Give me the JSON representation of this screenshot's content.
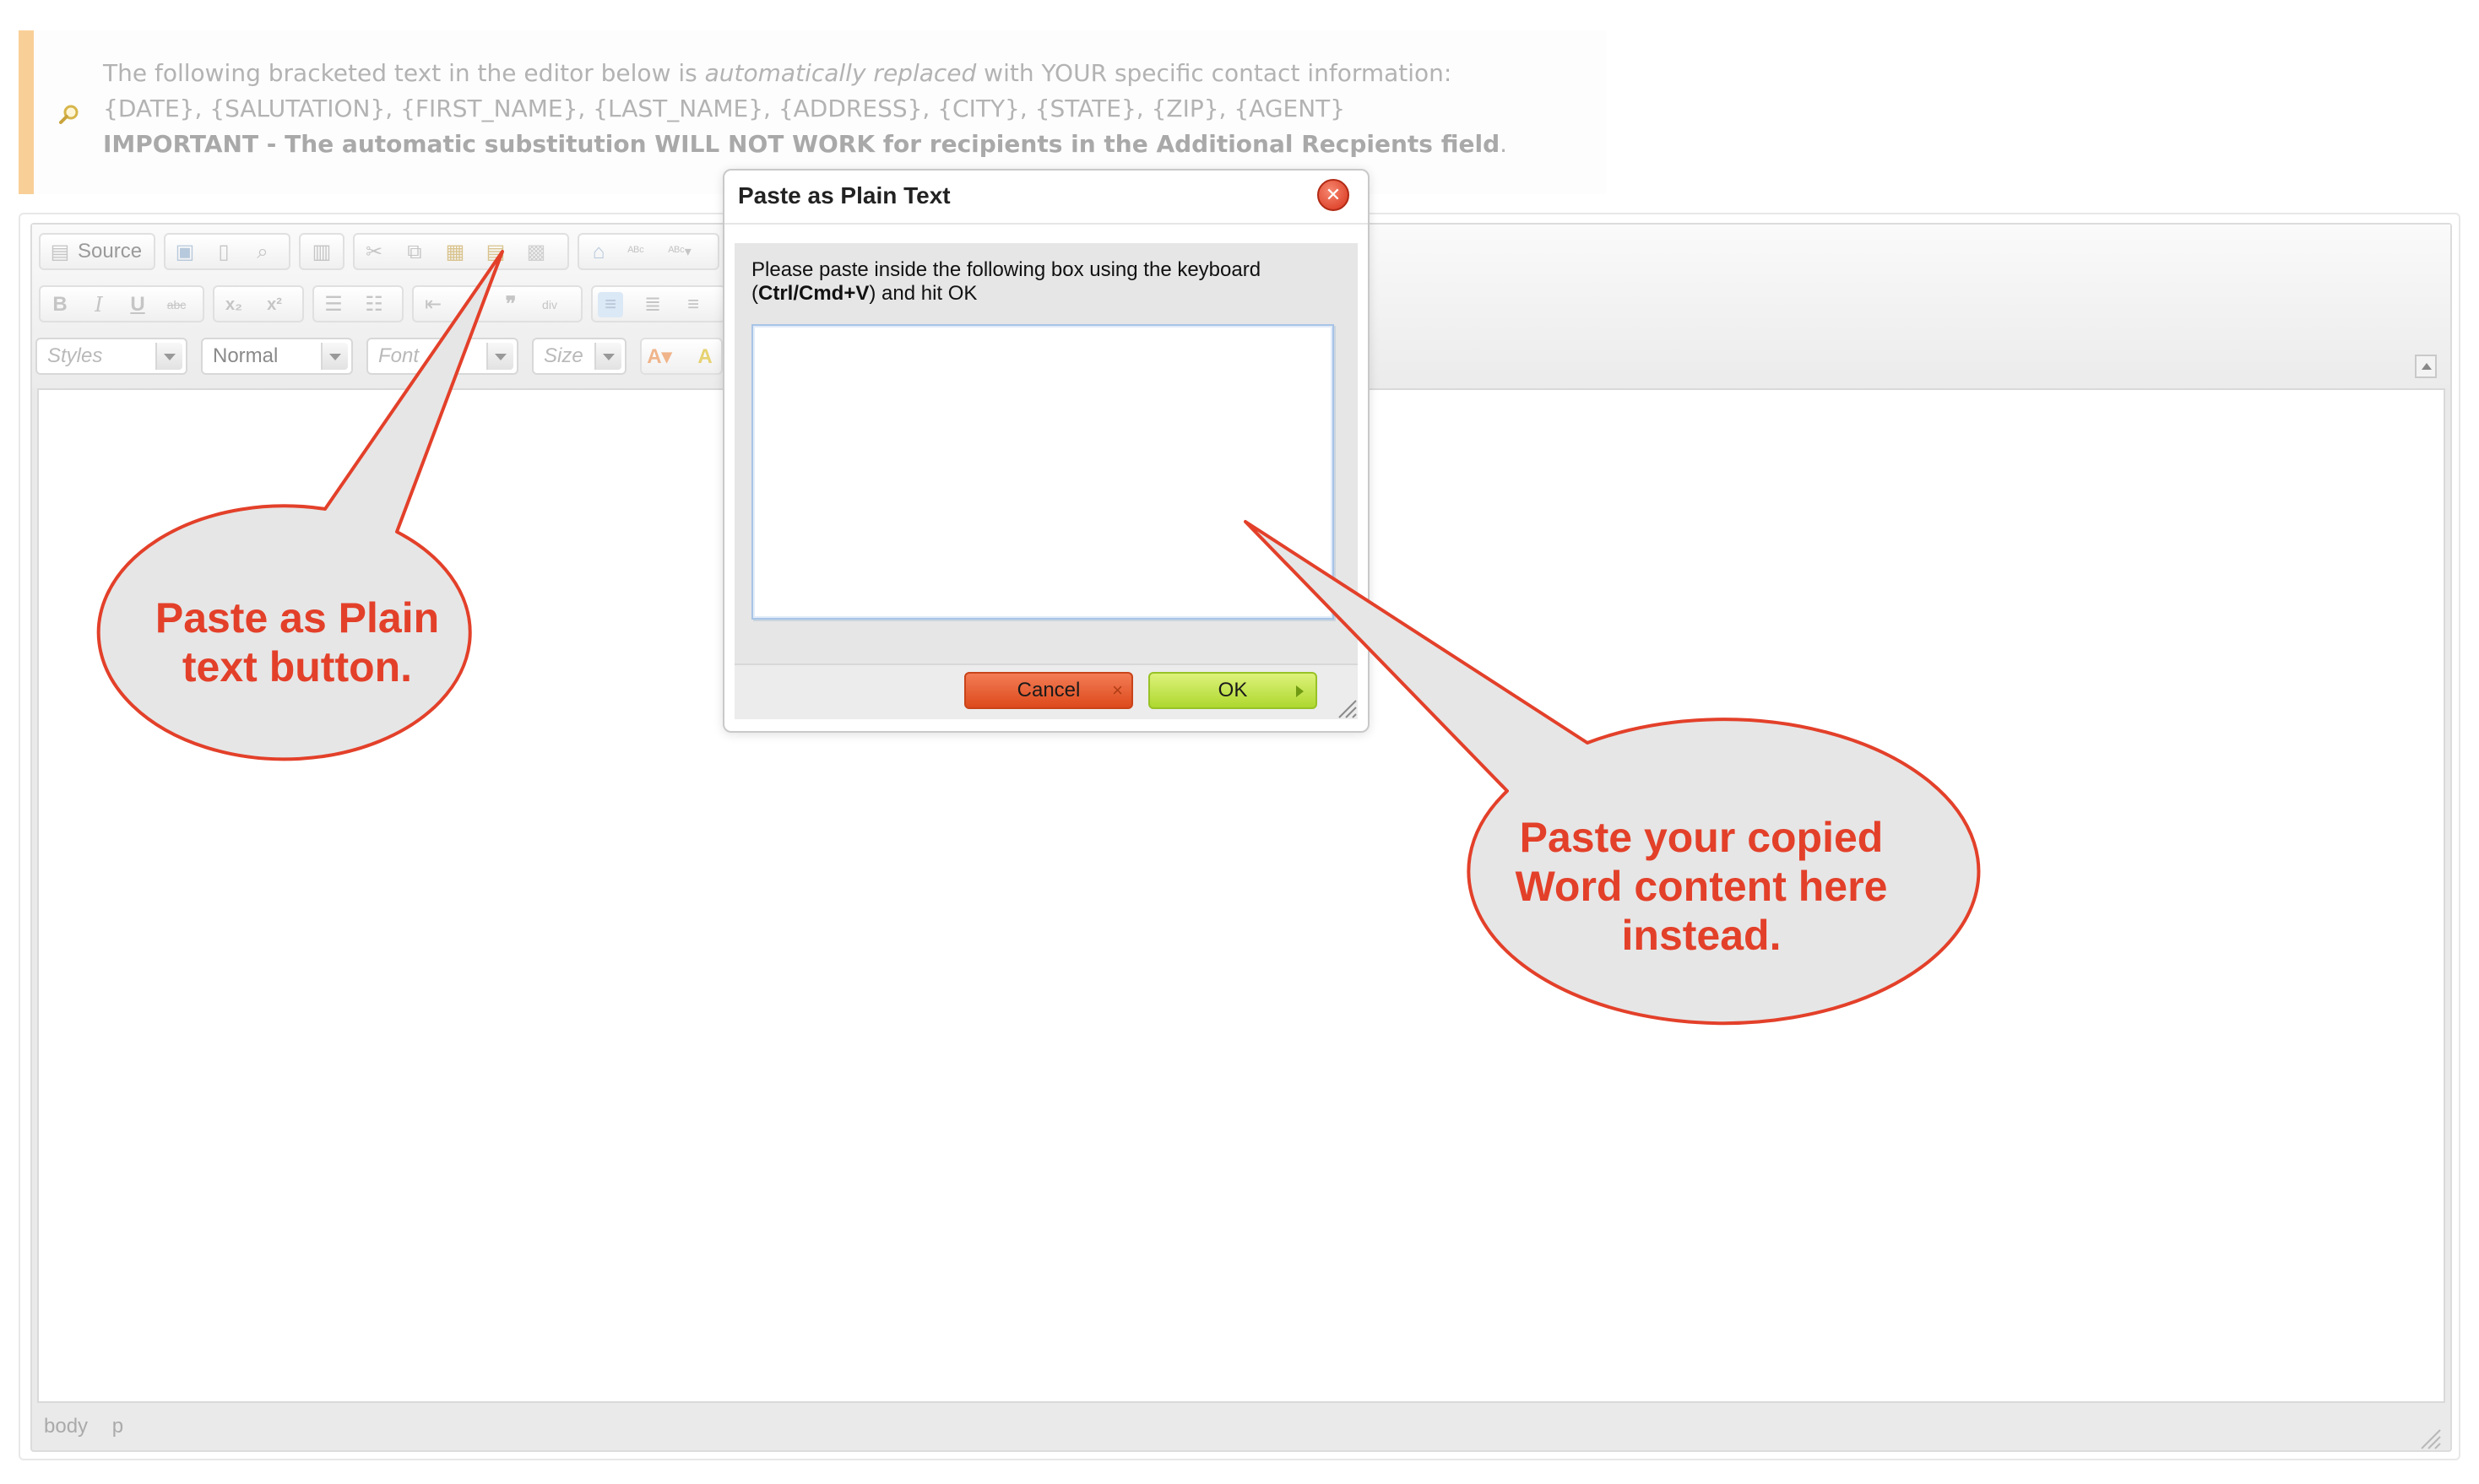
{
  "notice": {
    "line1_pre": "The following bracketed text in the editor below is ",
    "line1_em": "automatically replaced",
    "line1_post": " with YOUR specific contact information:",
    "line2": "{DATE}, {SALUTATION}, {FIRST_NAME}, {LAST_NAME}, {ADDRESS}, {CITY}, {STATE}, {ZIP}, {AGENT}",
    "line3_bold": "IMPORTANT - The automatic substitution WILL NOT WORK for recipients in the Additional Recpients field",
    "line3_end": ".",
    "icon": "magnifier-icon"
  },
  "toolbar": {
    "source_label": "Source",
    "styles_label": "Styles",
    "format_label": "Normal",
    "font_label": "Font",
    "size_label": "Size"
  },
  "statusbar": {
    "path": [
      "body",
      "p"
    ]
  },
  "dialog": {
    "title": "Paste as Plain Text",
    "instruction_pre": "Please paste inside the following box using the keyboard (",
    "instruction_keys": "Ctrl/Cmd+V",
    "instruction_post": ") and hit OK",
    "textarea_value": "",
    "cancel_label": "Cancel",
    "ok_label": "OK"
  },
  "annotations": {
    "callout1_line1": "Paste as Plain",
    "callout1_line2": "text button.",
    "callout2_line1": "Paste your copied",
    "callout2_line2": "Word content here",
    "callout2_line3": "instead.",
    "callout_color": "#e3402a",
    "bubble_fill": "#e6e6e6"
  }
}
